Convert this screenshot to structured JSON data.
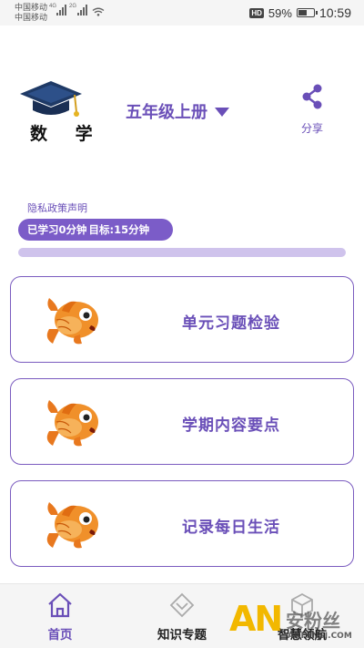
{
  "status_bar": {
    "carrier1": "中国移动",
    "carrier2": "中国移动",
    "net1": "4G",
    "net2": "2G",
    "hd": "HD",
    "battery": "59%",
    "battery_level": 0.59,
    "time": "10:59"
  },
  "header": {
    "subject": "数 学",
    "grade": "五年级上册",
    "share_label": "分享"
  },
  "privacy_link": "隐私政策声明",
  "study": {
    "learned": "已学习0分钟",
    "target": "目标:15分钟",
    "progress": 0.0
  },
  "cards": [
    {
      "label": "单元习题检验",
      "icon": "koi-fish-icon"
    },
    {
      "label": "学期内容要点",
      "icon": "koi-fish-icon"
    },
    {
      "label": "记录每日生活",
      "icon": "koi-fish-icon"
    }
  ],
  "nav": {
    "items": [
      {
        "label": "首页",
        "icon": "home-icon",
        "active": true
      },
      {
        "label": "知识专题",
        "icon": "diamond-icon",
        "active": false
      },
      {
        "label": "智慧领航",
        "icon": "cube-icon",
        "active": false
      }
    ]
  },
  "watermark": {
    "brand": "AN",
    "cn": "安粉丝",
    "url": "ANFENSI.COM"
  },
  "colors": {
    "accent": "#6a4fb8",
    "pill": "#7b5cc8",
    "track": "#cfc3ec",
    "fish": "#f0902a"
  }
}
